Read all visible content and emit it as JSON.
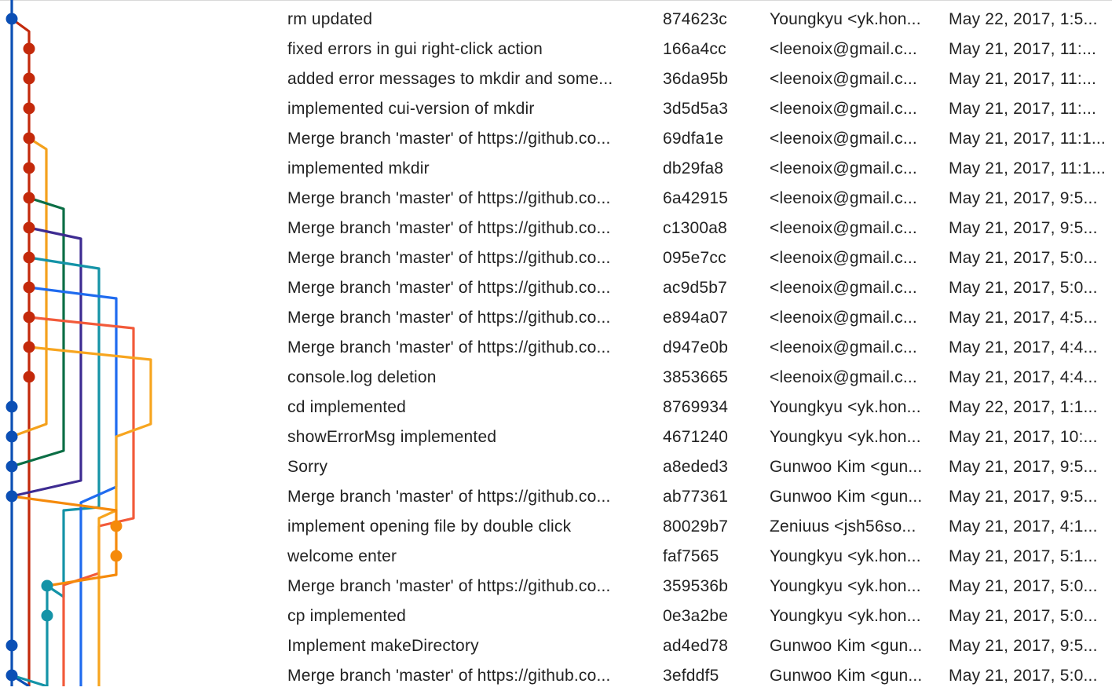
{
  "colors": {
    "blue": "#0b4fb5",
    "red": "#c3290b",
    "orange": "#f4a11c",
    "green": "#0b6e45",
    "purple": "#3d2b91",
    "teal": "#1493a7",
    "brightblue": "#1f6bef",
    "coral": "#f25a3a",
    "amber": "#f7a51f",
    "darkorange": "#f58a0b"
  },
  "commits": [
    {
      "message": "rm updated",
      "hash": "874623c",
      "author": "Youngkyu <yk.hon...",
      "date": "May 22, 2017, 1:5..."
    },
    {
      "message": "fixed errors in gui right-click action",
      "hash": "166a4cc",
      "author": " <leenoix@gmail.c...",
      "date": "May 21, 2017, 11:..."
    },
    {
      "message": "added error messages to mkdir and some...",
      "hash": "36da95b",
      "author": " <leenoix@gmail.c...",
      "date": "May 21, 2017, 11:..."
    },
    {
      "message": "implemented cui-version of mkdir",
      "hash": "3d5d5a3",
      "author": " <leenoix@gmail.c...",
      "date": "May 21, 2017, 11:..."
    },
    {
      "message": "Merge branch 'master' of https://github.co...",
      "hash": "69dfa1e",
      "author": " <leenoix@gmail.c...",
      "date": "May 21, 2017, 11:1..."
    },
    {
      "message": "implemented mkdir",
      "hash": "db29fa8",
      "author": " <leenoix@gmail.c...",
      "date": "May 21, 2017, 11:1..."
    },
    {
      "message": "Merge branch 'master' of https://github.co...",
      "hash": "6a42915",
      "author": " <leenoix@gmail.c...",
      "date": "May 21, 2017, 9:5..."
    },
    {
      "message": "Merge branch 'master' of https://github.co...",
      "hash": "c1300a8",
      "author": " <leenoix@gmail.c...",
      "date": "May 21, 2017, 9:5..."
    },
    {
      "message": "Merge branch 'master' of https://github.co...",
      "hash": "095e7cc",
      "author": " <leenoix@gmail.c...",
      "date": "May 21, 2017, 5:0..."
    },
    {
      "message": "Merge branch 'master' of https://github.co...",
      "hash": "ac9d5b7",
      "author": " <leenoix@gmail.c...",
      "date": "May 21, 2017, 5:0..."
    },
    {
      "message": "Merge branch 'master' of https://github.co...",
      "hash": "e894a07",
      "author": " <leenoix@gmail.c...",
      "date": "May 21, 2017, 4:5..."
    },
    {
      "message": "Merge branch 'master' of https://github.co...",
      "hash": "d947e0b",
      "author": " <leenoix@gmail.c...",
      "date": "May 21, 2017, 4:4..."
    },
    {
      "message": "console.log deletion",
      "hash": "3853665",
      "author": " <leenoix@gmail.c...",
      "date": "May 21, 2017, 4:4..."
    },
    {
      "message": "cd implemented",
      "hash": "8769934",
      "author": "Youngkyu <yk.hon...",
      "date": "May 22, 2017, 1:1..."
    },
    {
      "message": "showErrorMsg implemented",
      "hash": "4671240",
      "author": "Youngkyu <yk.hon...",
      "date": "May 21, 2017, 10:..."
    },
    {
      "message": "Sorry",
      "hash": "a8eded3",
      "author": "Gunwoo Kim <gun...",
      "date": "May 21, 2017, 9:5..."
    },
    {
      "message": "Merge branch 'master' of https://github.co...",
      "hash": "ab77361",
      "author": "Gunwoo Kim <gun...",
      "date": "May 21, 2017, 9:5..."
    },
    {
      "message": "implement opening file by double click",
      "hash": "80029b7",
      "author": "Zeniuus <jsh56so...",
      "date": "May 21, 2017, 4:1..."
    },
    {
      "message": "welcome enter",
      "hash": "faf7565",
      "author": "Youngkyu <yk.hon...",
      "date": "May 21, 2017, 5:1..."
    },
    {
      "message": "Merge branch 'master' of https://github.co...",
      "hash": "359536b",
      "author": "Youngkyu <yk.hon...",
      "date": "May 21, 2017, 5:0..."
    },
    {
      "message": "cp implemented",
      "hash": "0e3a2be",
      "author": "Youngkyu <yk.hon...",
      "date": "May 21, 2017, 5:0..."
    },
    {
      "message": "Implement makeDirectory",
      "hash": "ad4ed78",
      "author": "Gunwoo Kim <gun...",
      "date": "May 21, 2017, 9:5..."
    },
    {
      "message": "Merge branch 'master' of https://github.co...",
      "hash": "3efddf5",
      "author": "Gunwoo Kim <gun...",
      "date": "May 21, 2017, 5:0..."
    }
  ]
}
